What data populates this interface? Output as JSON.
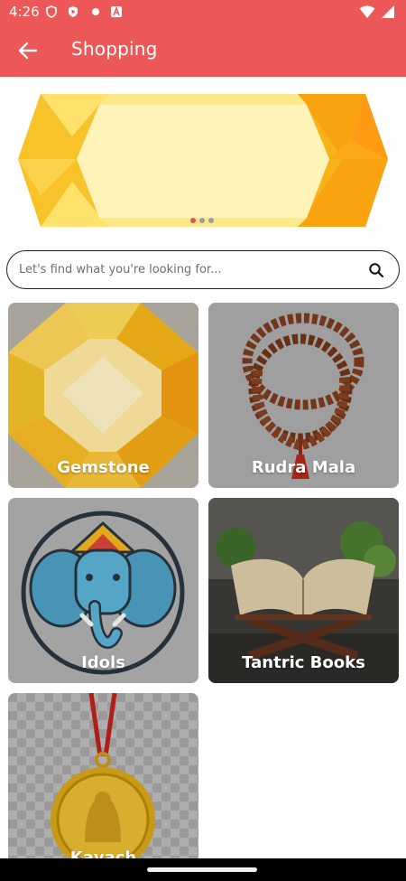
{
  "status": {
    "time": "4:26"
  },
  "header": {
    "title": "Shopping"
  },
  "banner": {
    "dots": 3,
    "active_dot": 0
  },
  "search": {
    "placeholder": "Let's find what you're looking for..."
  },
  "categories": [
    {
      "label": "Gemstone",
      "icon": "gemstone-image"
    },
    {
      "label": "Rudra Mala",
      "icon": "rudraksha-mala-image"
    },
    {
      "label": "Idols",
      "icon": "ganesha-idol-image"
    },
    {
      "label": "Tantric Books",
      "icon": "book-stand-image"
    },
    {
      "label": "Kavach",
      "icon": "gold-medallion-image"
    }
  ],
  "colors": {
    "app_bar": "#ec5757",
    "dot_active": "#e0564c",
    "card_bg": "#a8a8a8"
  }
}
